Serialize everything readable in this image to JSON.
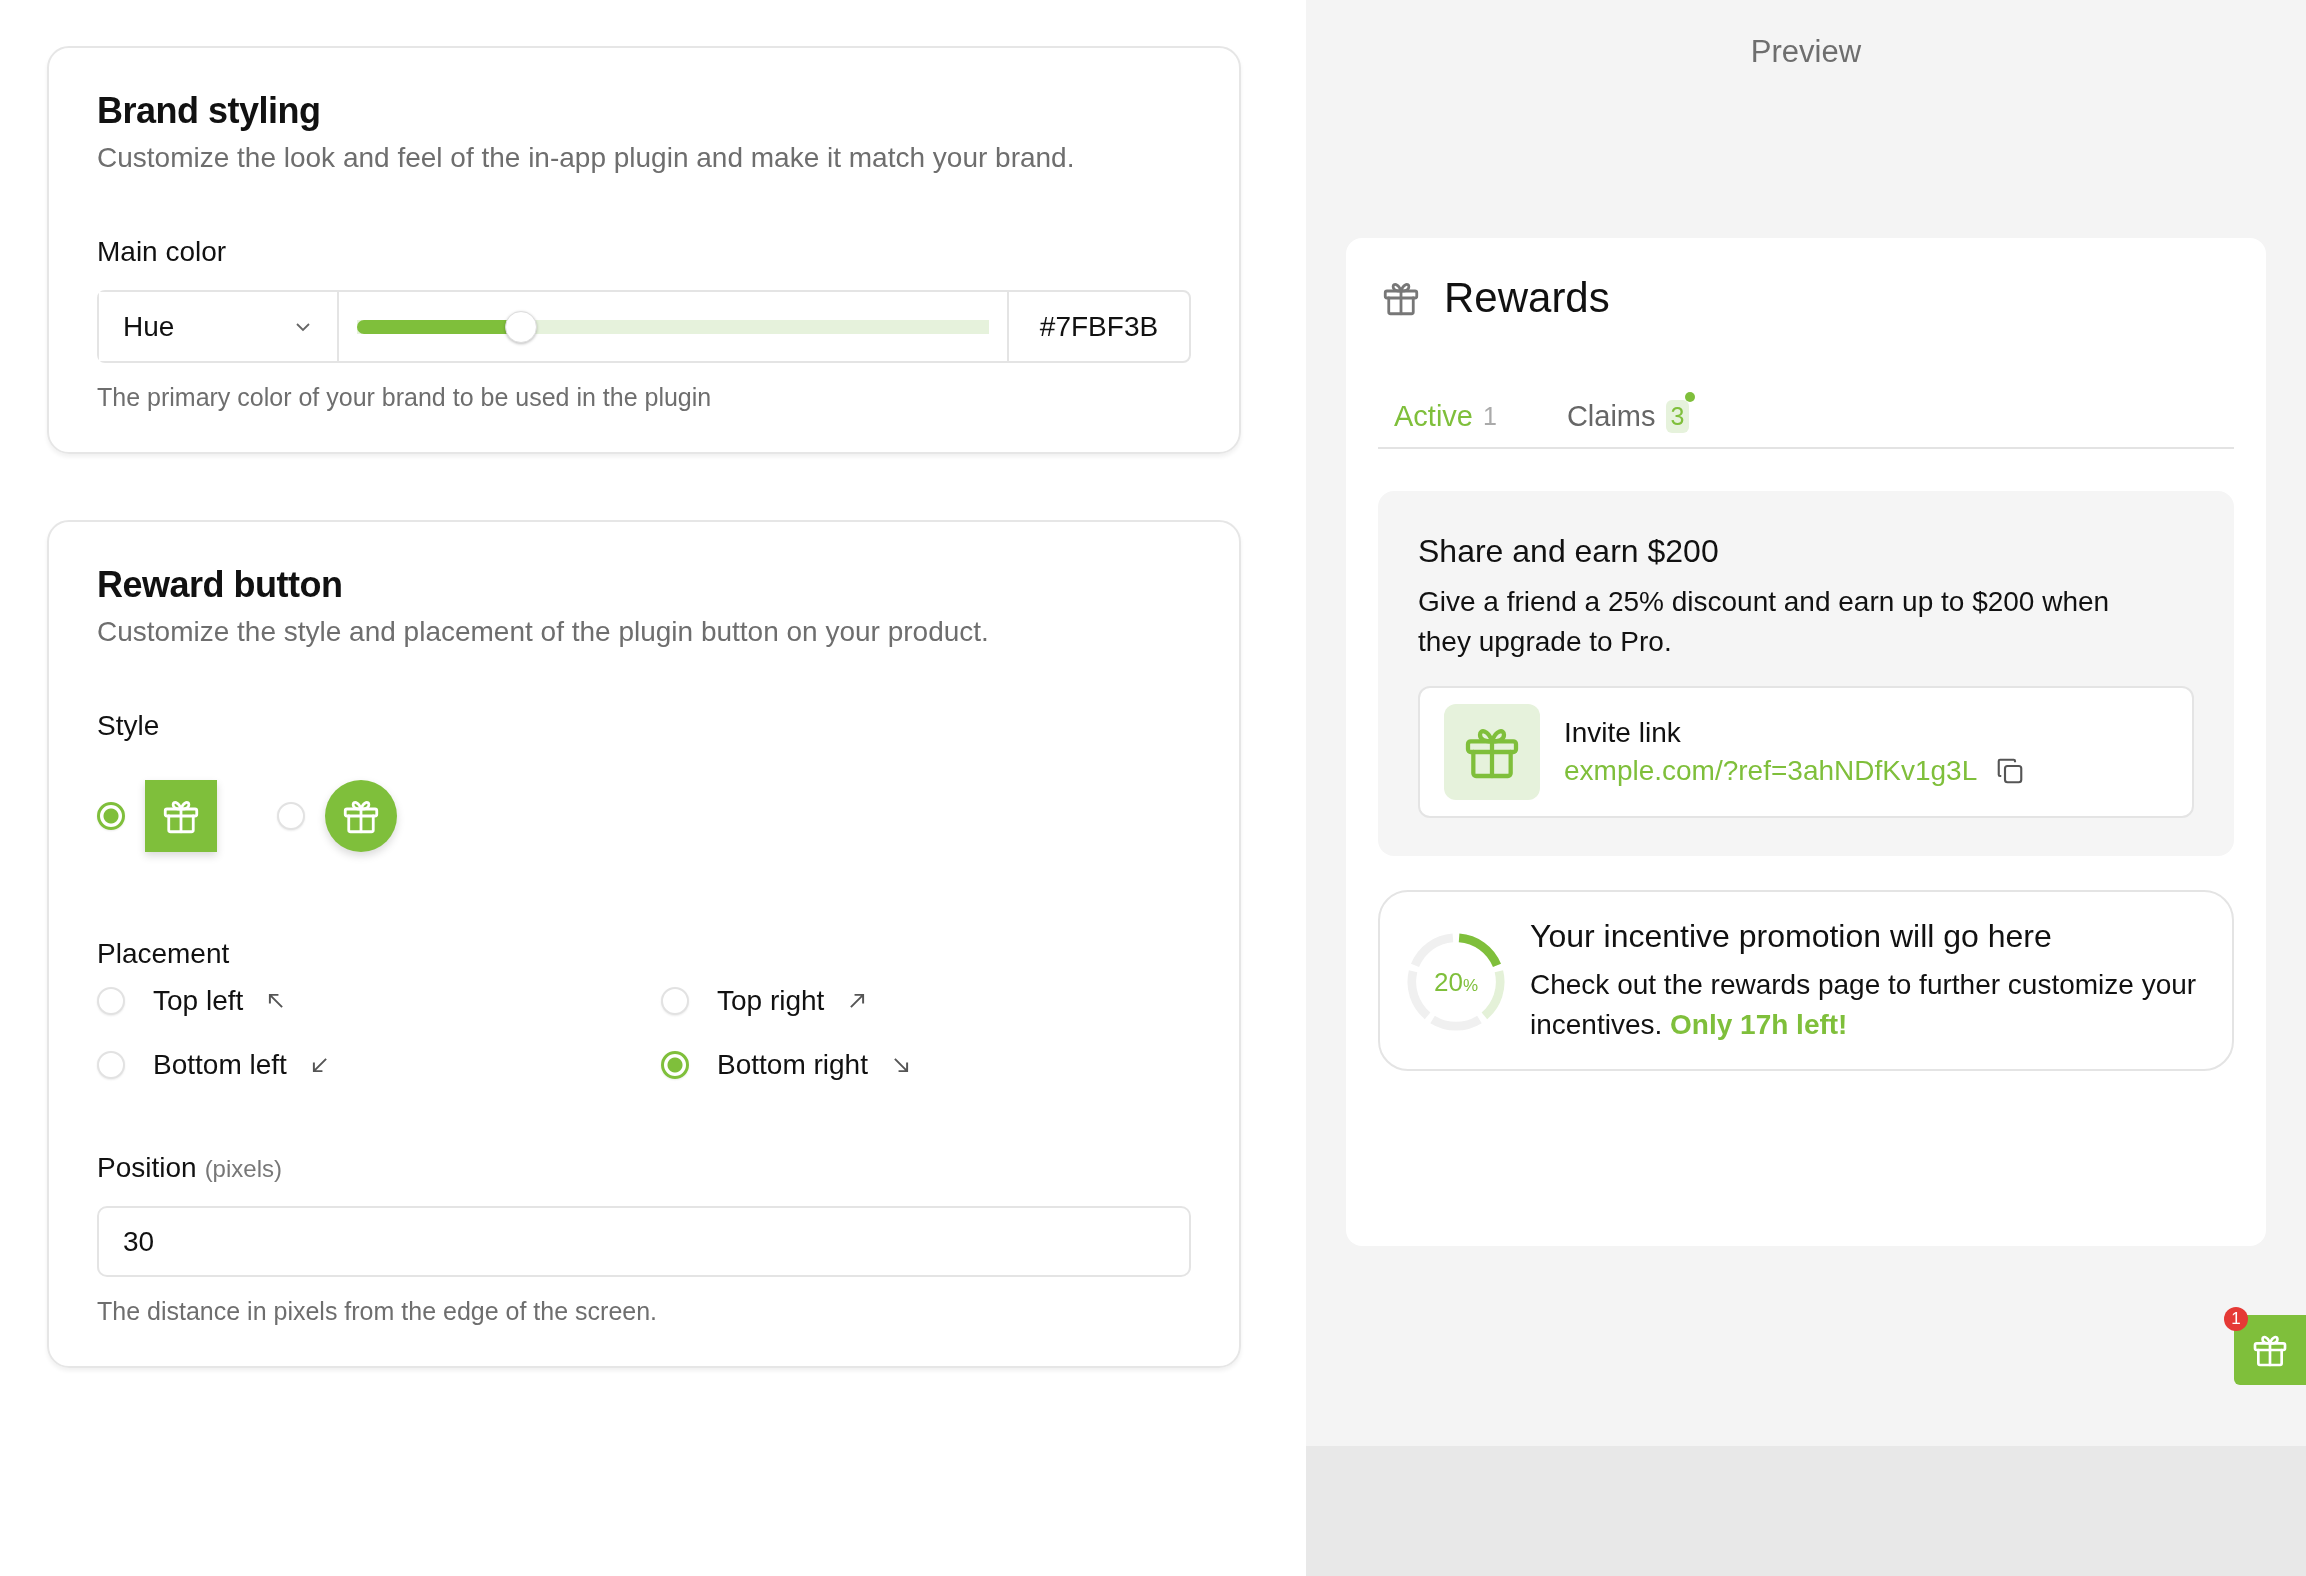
{
  "brand_styling": {
    "title": "Brand styling",
    "description": "Customize the look and feel of the in-app plugin and make it match your brand.",
    "main_color": {
      "label": "Main color",
      "mode": "Hue",
      "level": 0.26,
      "hex": "#7FBF3B",
      "help": "The primary color of your brand to be used in the plugin"
    }
  },
  "reward_button": {
    "title": "Reward button",
    "description": "Customize the style and placement of the plugin button on your product.",
    "style": {
      "label": "Style",
      "options": [
        {
          "kind": "square",
          "selected": true
        },
        {
          "kind": "round",
          "selected": false
        }
      ]
    },
    "placement": {
      "label": "Placement",
      "options": [
        {
          "label": "Top left",
          "kind": "top-left",
          "selected": false
        },
        {
          "label": "Top right",
          "kind": "top-right",
          "selected": false
        },
        {
          "label": "Bottom left",
          "kind": "bottom-left",
          "selected": false
        },
        {
          "label": "Bottom right",
          "kind": "bottom-right",
          "selected": true
        }
      ]
    },
    "position": {
      "label": "Position",
      "hint": "(pixels)",
      "value": "30",
      "help": "The distance in pixels from the edge of the screen."
    }
  },
  "preview": {
    "title": "Preview",
    "widget": {
      "title": "Rewards",
      "tabs": [
        {
          "label": "Active",
          "count": "1",
          "kind": "plain",
          "dot": false,
          "selected": true
        },
        {
          "label": "Claims",
          "count": "3",
          "kind": "badge",
          "dot": true,
          "selected": false
        }
      ],
      "referral": {
        "title": "Share and earn $200",
        "description": "Give a friend a 25% discount and earn up to $200 when they upgrade to Pro.",
        "link_label": "Invite link",
        "link": "exmple.com/?ref=3ahNDfKv1g3L"
      },
      "promo": {
        "value": "20",
        "unit": "%",
        "level": 0.2,
        "title": "Your incentive promotion will go here",
        "description": "Check out the rewards page to further customize your incentives. **Only 17h left!**"
      }
    },
    "launcher": {
      "badge": "1"
    }
  }
}
